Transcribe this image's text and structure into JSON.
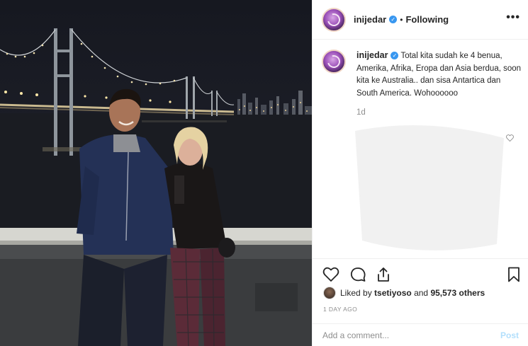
{
  "header": {
    "username": "inijedar",
    "verified_icon": "verified-badge-icon",
    "separator": "•",
    "follow_status": "Following",
    "more_icon": "more-options-icon",
    "more_glyph": "•••"
  },
  "caption": {
    "username": "inijedar",
    "text": "Total kita sudah ke 4 benua, Amerika, Afrika, Eropa dan Asia berdua, soon kita ke Australia.. dan sisa Antartica dan South America. Wohoooooo",
    "age": "1d"
  },
  "actions": {
    "like_icon": "heart-outline-icon",
    "comment_icon": "comment-bubble-icon",
    "share_icon": "share-icon",
    "save_icon": "bookmark-icon"
  },
  "likes": {
    "prefix": "Liked by ",
    "user": "tsetiyoso",
    "middle": " and ",
    "count": "95,573 others"
  },
  "timestamp": "1 DAY AGO",
  "comment": {
    "placeholder": "Add a comment...",
    "post_label": "Post"
  },
  "colors": {
    "link_blue": "#3897f0",
    "post_disabled": "#b2dffc",
    "muted": "#8e8e8e",
    "text": "#262626",
    "border": "#efefef"
  }
}
